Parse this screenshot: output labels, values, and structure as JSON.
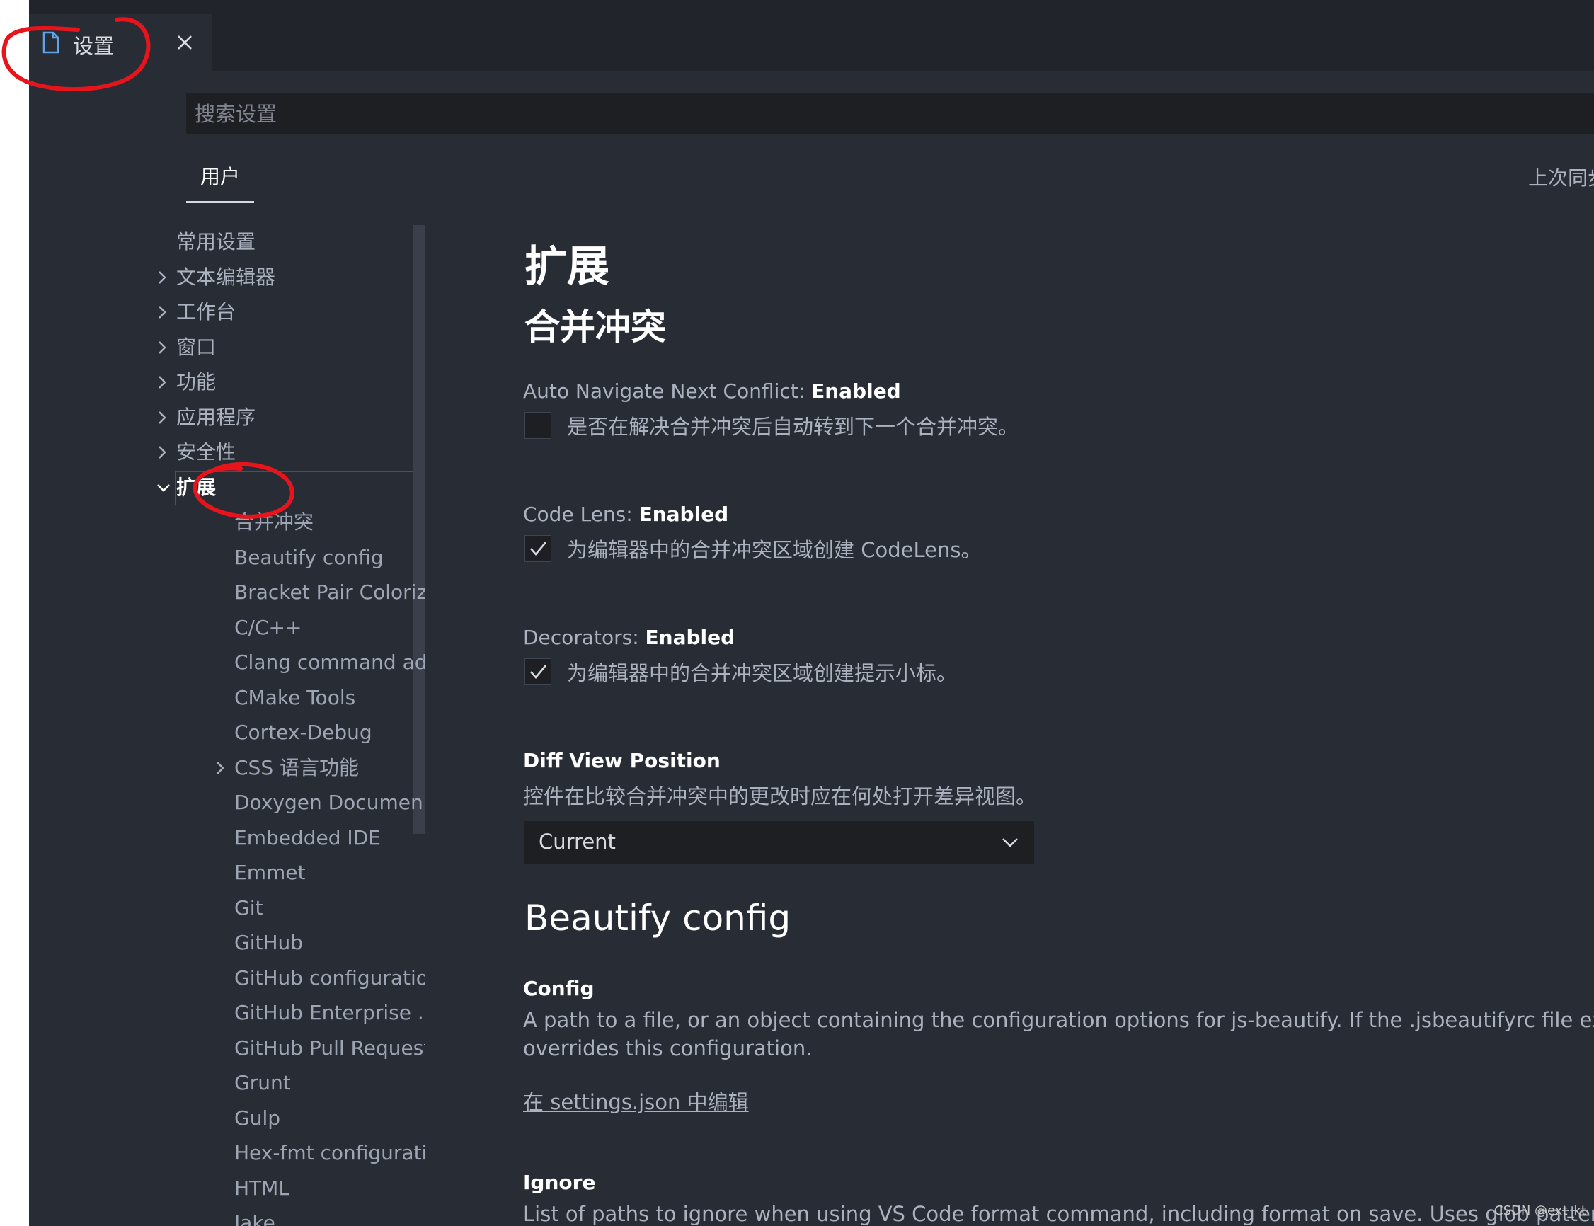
{
  "tab": {
    "label": "设置",
    "icon": "file-icon",
    "close_icon": "close-icon"
  },
  "search": {
    "placeholder": "搜索设置"
  },
  "scope_tabs": {
    "user": "用户",
    "last_sync": "上次同步"
  },
  "toc": {
    "top_items": [
      {
        "label": "常用设置",
        "expandable": false
      },
      {
        "label": "文本编辑器",
        "expandable": true
      },
      {
        "label": "工作台",
        "expandable": true
      },
      {
        "label": "窗口",
        "expandable": true
      },
      {
        "label": "功能",
        "expandable": true
      },
      {
        "label": "应用程序",
        "expandable": true
      },
      {
        "label": "安全性",
        "expandable": true
      },
      {
        "label": "扩展",
        "expandable": true,
        "expanded": true,
        "selected": true
      }
    ],
    "extensions": [
      "合并冲突",
      "Beautify config",
      "Bracket Pair Coloriz...",
      "C/C++",
      "Clang command ad...",
      "CMake Tools",
      "Cortex-Debug",
      "CSS 语言功能",
      "Doxygen Documen...",
      "Embedded IDE",
      "Emmet",
      "Git",
      "GitHub",
      "GitHub configuration",
      "GitHub Enterprise ...",
      "GitHub Pull Requests",
      "Grunt",
      "Gulp",
      "Hex-fmt configurati...",
      "HTML",
      "Jake"
    ]
  },
  "content": {
    "heading": "扩展",
    "section_merge": "合并冲突",
    "auto_nav": {
      "prefix": "Auto Navigate Next Conflict: ",
      "name": "Enabled",
      "desc": "是否在解决合并冲突后自动转到下一个合并冲突。",
      "checked": false
    },
    "code_lens": {
      "prefix": "Code Lens: ",
      "name": "Enabled",
      "desc": "为编辑器中的合并冲突区域创建 CodeLens。",
      "checked": true
    },
    "decorators": {
      "prefix": "Decorators: ",
      "name": "Enabled",
      "desc": "为编辑器中的合并冲突区域创建提示小标。",
      "checked": true
    },
    "diff_view": {
      "name": "Diff View Position",
      "desc": "控件在比较合并冲突中的更改时应在何处打开差异视图。",
      "value": "Current"
    },
    "beautify": {
      "heading": "Beautify config",
      "config_name": "Config",
      "config_desc_1": "A path to a file, or an object containing the configuration options for js-beautify. If the .jsbeautifyrc file exists in project",
      "config_desc_2": "overrides this configuration.",
      "edit_link": "在 settings.json 中编辑",
      "ignore_name": "Ignore",
      "ignore_desc": "List of paths to ignore when using VS Code format command, including format on save. Uses glob pattern matching."
    }
  },
  "watermark": "CSDN @ext_kt",
  "colors": {
    "background": "#282c34",
    "tabbar": "#21252b",
    "input": "#1d1f23",
    "annotation": "#e8141c"
  }
}
